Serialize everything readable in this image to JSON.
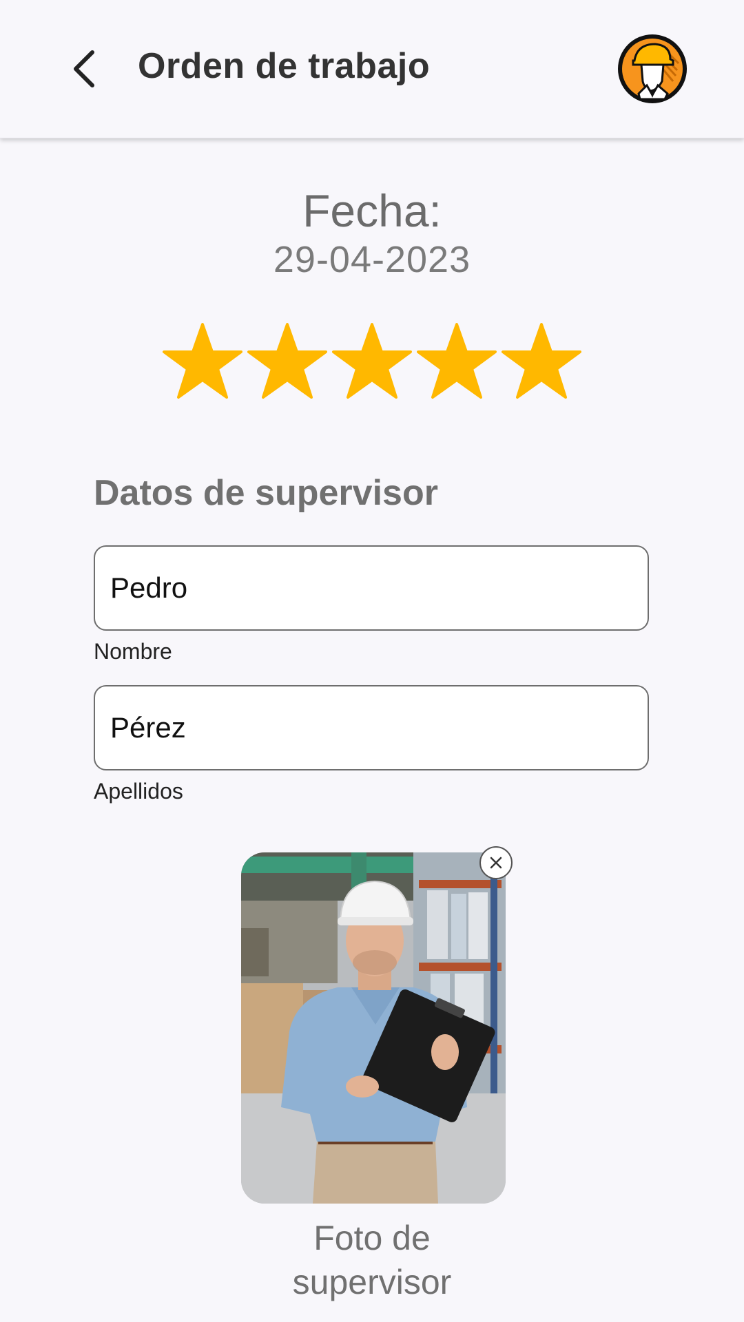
{
  "header": {
    "title": "Orden de trabajo",
    "back_icon": "chevron-left-icon",
    "avatar_icon": "construction-worker-icon"
  },
  "date": {
    "label": "Fecha:",
    "value": "29-04-2023"
  },
  "rating": {
    "value": 5,
    "max": 5,
    "color": "#FFB800"
  },
  "supervisor": {
    "section_title": "Datos de supervisor",
    "first_name": {
      "value": "Pedro",
      "helper": "Nombre"
    },
    "last_name": {
      "value": "Pérez",
      "helper": "Apellidos"
    },
    "photo": {
      "caption_line1": "Foto de",
      "caption_line2": "supervisor",
      "remove_icon": "close-icon"
    }
  },
  "colors": {
    "background": "#F8F7FB",
    "accent": "#F7941D",
    "star": "#FFB800"
  }
}
